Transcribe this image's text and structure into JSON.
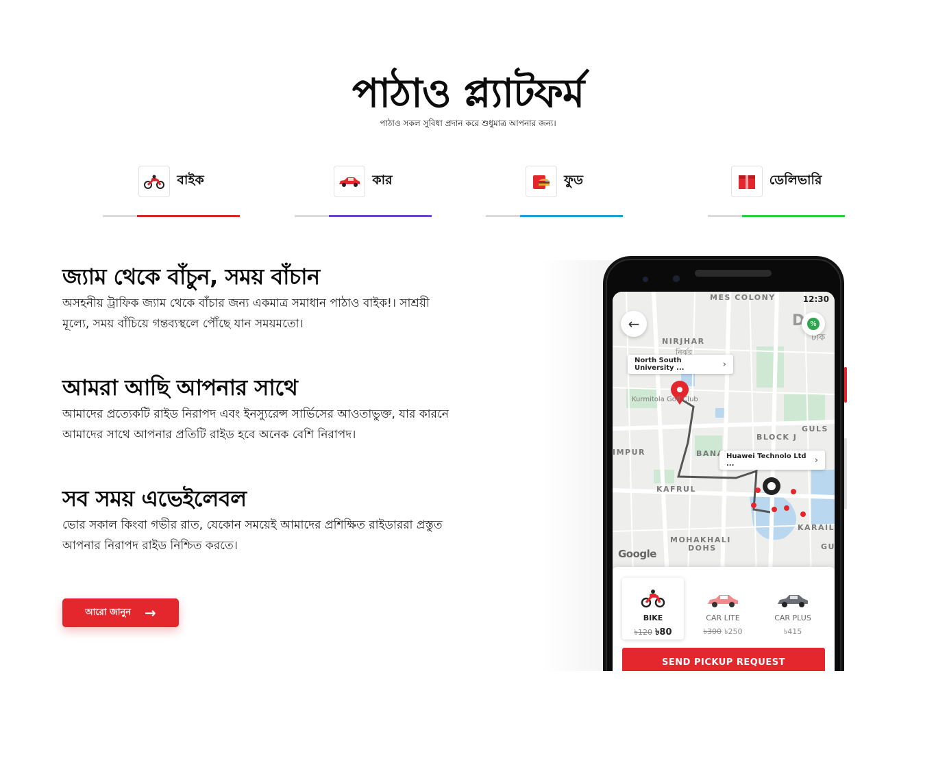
{
  "header": {
    "title": "পাঠাও প্ল্যাটফর্ম",
    "subtitle": "পাঠাও সকল সুবিধা প্রদান করে শুধুমাত্র আপনার জন্য।"
  },
  "tabs": [
    {
      "label": "বাইক",
      "icon": "motorbike-icon",
      "color": "#d9262c"
    },
    {
      "label": "কার",
      "icon": "car-icon",
      "color": "#6a46c8"
    },
    {
      "label": "ফুড",
      "icon": "food-icon",
      "color": "#1aa1d6"
    },
    {
      "label": "ডেলিভারি",
      "icon": "parcel-icon",
      "color": "#26d23b"
    }
  ],
  "features": [
    {
      "heading": "জ্যাম থেকে বাঁচুন, সময় বাঁচান",
      "text": "অসহনীয় ট্রাফিক জ্যাম থেকে বাঁচার জন্য একমাত্র সমাধান পাঠাও বাইক!। সাশ্রয়ী মূল্যে, সময় বাঁচিয়ে গন্তব্যস্থলে পৌঁছে যান সময়মতো।"
    },
    {
      "heading": "আমরা আছি আপনার সাথে",
      "text": "আমাদের প্রত্যেকটি রাইড নিরাপদ এবং ইনস্যুরেন্স সার্ভিসের আওতাভুক্ত, যার কারনে আমাদের সাথে আপনার প্রতিটি রাইড হবে অনেক বেশি নিরাপদ।"
    },
    {
      "heading": "সব সময় এভেইলেবল",
      "text": "ভোর সকাল কিংবা গভীর রাত, যেকোন সময়েই আমাদের প্রশিক্ষিত রাইডাররা প্রস্তুত আপনার নিরাপদ রাইড নিশ্চিত করতে।"
    }
  ],
  "cta": {
    "label": "আরো জানুন",
    "icon": "arrow-right-icon"
  },
  "phone": {
    "time": "12:30",
    "map_labels": {
      "mes_colony": "MES COLONY",
      "nirjhar": "NIRJHAR",
      "nirjhar_bn": "নির্ঝর",
      "kurmitola": "Kurmitola Golf Club",
      "block_j": "BLOCK J",
      "gulshan": "GULS",
      "impur": "IMPUR",
      "bana": "BANA",
      "kafrul": "KAFRUL",
      "mohakhali": "MOHAKHALI",
      "dohs": "DOHS",
      "karail": "KARAIL",
      "gu": "GU",
      "dhaka": "D   a",
      "dhaka_bn": "ঢাক"
    },
    "pickup": "North South University ...",
    "destination": "Huawei Technolo Ltd ...",
    "google": "Google",
    "options": [
      {
        "name": "BIKE",
        "old": "৳120",
        "price": "৳80",
        "icon": "motorbike-icon"
      },
      {
        "name": "CAR LITE",
        "old": "৳300",
        "price": "৳250",
        "icon": "car-lite-icon"
      },
      {
        "name": "CAR PLUS",
        "old": "",
        "price": "৳415",
        "icon": "car-plus-icon"
      }
    ],
    "send_label": "SEND PICKUP REQUEST",
    "accent": "#e3272d"
  }
}
